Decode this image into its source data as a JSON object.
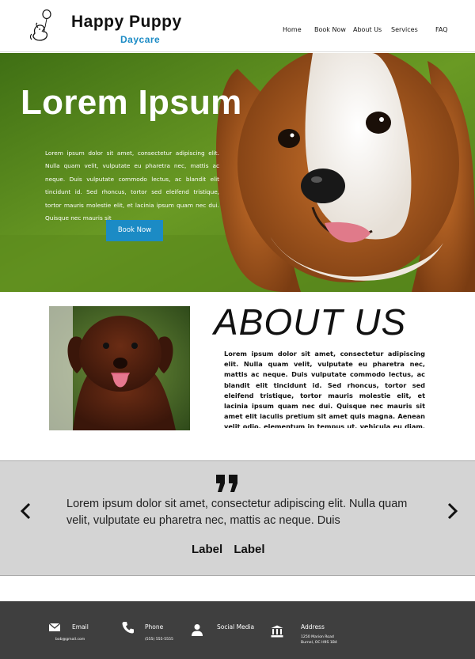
{
  "header": {
    "brand_title": "Happy Puppy",
    "brand_subtitle": "Daycare",
    "nav": [
      "Home",
      "Book Now",
      "About Us",
      "Services",
      "FAQ"
    ]
  },
  "hero": {
    "title": "Lorem Ipsum",
    "text": "Lorem ipsum dolor sit amet, consectetur adipiscing elit. Nulla quam velit, vulputate eu pharetra nec, mattis ac neque. Duis vulputate commodo lectus, ac blandit elit tincidunt id. Sed rhoncus, tortor sed eleifend tristique, tortor mauris molestie elit, et lacinia ipsum quam nec dui. Quisque nec mauris sit",
    "button_label": "Book Now"
  },
  "about": {
    "title": "ABOUT US",
    "text": "Lorem ipsum dolor sit amet, consectetur adipiscing elit. Nulla quam velit, vulputate eu pharetra nec, mattis ac neque. Duis vulputate commodo lectus, ac blandit elit tincidunt id. Sed rhoncus, tortor sed eleifend tristique, tortor mauris molestie elit, et lacinia ipsum quam nec dui. Quisque nec mauris sit amet elit iaculis pretium sit amet quis magna. Aenean velit odio, elementum in tempus ut, vehicula eu diam. Pellentesque rhoncus"
  },
  "testimonial": {
    "quote": "Lorem ipsum dolor sit amet, consectetur adipiscing elit. Nulla quam velit, vulputate eu pharetra nec, mattis ac neque. Duis",
    "labels": [
      "Label",
      "Label"
    ]
  },
  "footer": {
    "email": {
      "label": "Email",
      "value": "bob@gmail.com"
    },
    "phone": {
      "label": "Phone",
      "value": "(555) 555-5555"
    },
    "social": {
      "label": "Social Media"
    },
    "address": {
      "label": "Address",
      "line1": "1250 Marion Road",
      "line2": "Burnel, OC H9S 1B4"
    }
  },
  "colors": {
    "accent": "#1b8bc5",
    "footer_bg": "#3f3f3f",
    "testimonial_bg": "#d4d4d4"
  }
}
